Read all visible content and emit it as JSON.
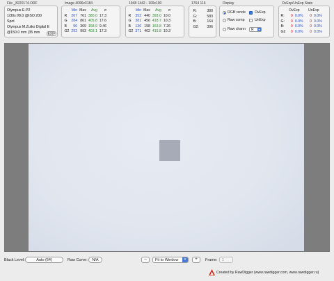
{
  "colors": {
    "background": "#ececec",
    "viewer_border": "#7d7d7d",
    "image_bg": "#e1e6ef",
    "sample_square": "#a7abb7",
    "min_color": "#2a4fd0",
    "avg_color": "#2a8a2a",
    "clip_color": "#d02020",
    "logo_red": "#d62a1e"
  },
  "file_panel": {
    "title": "File _8220174.ORF",
    "lines": [
      "Olympus E-P2",
      "1/30s f/8.0 @ISO 200",
      "Spot",
      "Olympus M.Zuiko Digital E",
      "@150.0 mm (35 mm"
    ],
    "exif_button": "EXIF"
  },
  "image_panel": {
    "title": "Image 4096x3184",
    "headers": [
      "Min",
      "Max",
      "Avg",
      "σ"
    ],
    "rows": [
      {
        "ch": "R",
        "min": "267",
        "max": "761",
        "avg": "380.0",
        "sigma": "17.3"
      },
      {
        "ch": "G",
        "min": "284",
        "max": "861",
        "avg": "405.8",
        "sigma": "17.6"
      },
      {
        "ch": "B",
        "min": "96",
        "max": "369",
        "avg": "158.9",
        "sigma": "9.46"
      },
      {
        "ch": "G2",
        "min": "292",
        "max": "993",
        "avg": "403.1",
        "sigma": "17.3"
      }
    ]
  },
  "selection_panel": {
    "title": "1948 1442 - 100x100",
    "headers": [
      "Min",
      "Max",
      "Avg",
      "σ"
    ],
    "rows": [
      {
        "ch": "R",
        "min": "352",
        "max": "440",
        "avg": "393.0",
        "sigma": "10.0"
      },
      {
        "ch": "G",
        "min": "381",
        "max": "456",
        "avg": "418.7",
        "sigma": "10.3"
      },
      {
        "ch": "B",
        "min": "136",
        "max": "198",
        "avg": "163.8",
        "sigma": "7.26"
      },
      {
        "ch": "G2",
        "min": "371",
        "max": "462",
        "avg": "415.8",
        "sigma": "10.3"
      }
    ]
  },
  "point_panel": {
    "title": "1764 116",
    "rows": [
      {
        "ch": "R:",
        "value": "380"
      },
      {
        "ch": "G:",
        "value": "583"
      },
      {
        "ch": "B:",
        "value": "164"
      },
      {
        "ch": "G2:",
        "value": "396"
      }
    ]
  },
  "display_panel": {
    "title": "Display",
    "rgb_render": "RGB rende",
    "raw_comp": "Raw comp",
    "raw_chan": "Raw chann",
    "ovexp": "OvExp",
    "unexp": "UnExp",
    "channel_select": "R"
  },
  "stats_panel": {
    "title": "OvExp/UnExp Stats",
    "headers": [
      "OvExp",
      "UnExp"
    ],
    "rows": [
      {
        "ch": "R:",
        "ov_n": "0",
        "ov_p": "0.0%",
        "un_n": "0",
        "un_p": "0.0%"
      },
      {
        "ch": "G:",
        "ov_n": "0",
        "ov_p": "0.0%",
        "un_n": "0",
        "un_p": "0.0%"
      },
      {
        "ch": "B:",
        "ov_n": "0",
        "ov_p": "0.0%",
        "un_n": "0",
        "un_p": "0.0%"
      },
      {
        "ch": "G2",
        "ov_n": "0",
        "ov_p": "0.0%",
        "un_n": "0",
        "un_p": "0.0%"
      }
    ]
  },
  "bottom_bar": {
    "black_level_label": "Black Level:",
    "black_level_value": "Auto (64)",
    "raw_curve_label": "Raw Curve:",
    "raw_curve_value": "N/A",
    "zoom_out": "–",
    "zoom_select": "Fit to Window",
    "zoom_in": "+",
    "frame_label": "Frame:",
    "frame_value": "1"
  },
  "credit": "Created by RawDigger (www.rawdigger.com, www.rawdigger.ru)"
}
